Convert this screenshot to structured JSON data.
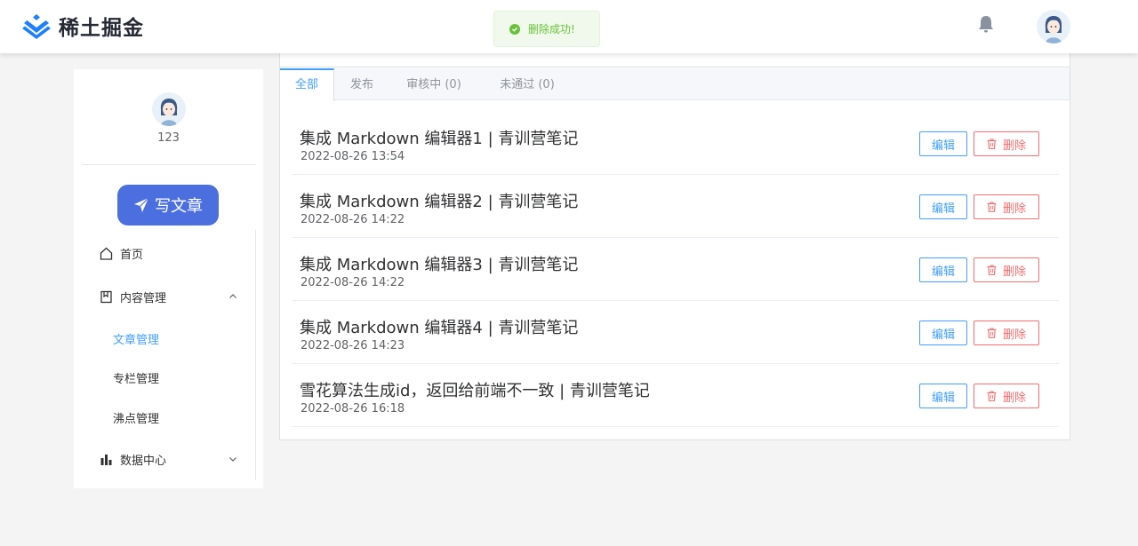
{
  "header": {
    "logo_text": "稀土掘金",
    "toast": "删除成功!",
    "brand_color": "#1e80ff"
  },
  "sidebar": {
    "username": "123",
    "write_label": "写文章",
    "menu": {
      "home": "首页",
      "content": "内容管理",
      "data": "数据中心"
    },
    "sub_items": [
      "文章管理",
      "专栏管理",
      "沸点管理"
    ]
  },
  "tabs": [
    "全部",
    "发布",
    "审核中 (0)",
    "未通过 (0)"
  ],
  "actions": {
    "edit": "编辑",
    "delete": "删除"
  },
  "articles": [
    {
      "title": "集成 Markdown 编辑器1 | 青训营笔记",
      "date": "2022-08-26 13:54"
    },
    {
      "title": "集成 Markdown 编辑器2 | 青训营笔记",
      "date": "2022-08-26 14:22"
    },
    {
      "title": "集成 Markdown 编辑器3 | 青训营笔记",
      "date": "2022-08-26 14:22"
    },
    {
      "title": "集成 Markdown 编辑器4 | 青训营笔记",
      "date": "2022-08-26 14:23"
    },
    {
      "title": "雪花算法生成id，返回给前端不一致 | 青训营笔记",
      "date": "2022-08-26 16:18"
    }
  ],
  "colors": {
    "accent": "#409eff",
    "danger": "#f56c6c",
    "success": "#67c23a",
    "write_button": "#4c6fe0"
  }
}
